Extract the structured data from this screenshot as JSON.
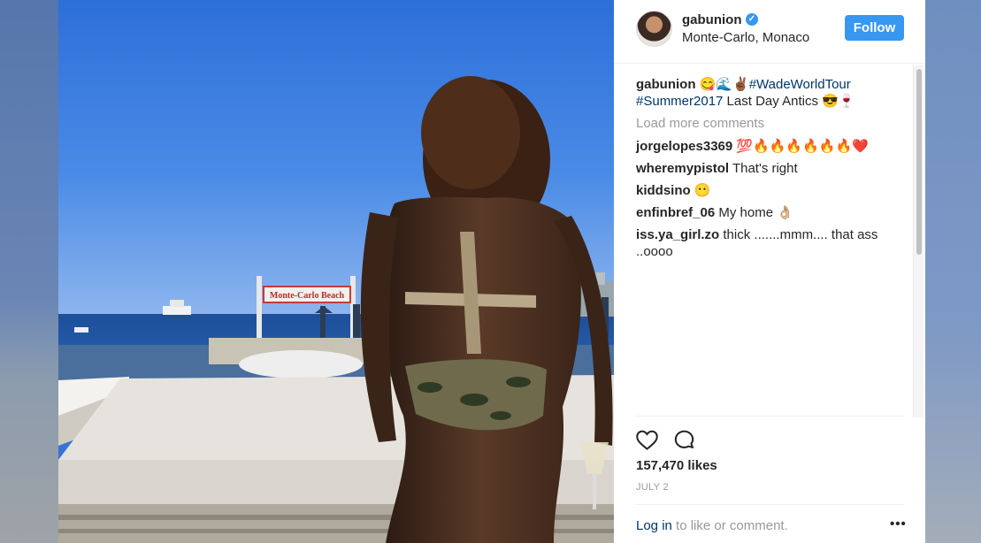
{
  "post": {
    "username": "gabunion",
    "location": "Monte-Carlo, Monaco",
    "follow_label": "Follow",
    "photo_sign_text": "Monte-Carlo Beach"
  },
  "caption": {
    "username": "gabunion",
    "emoji": "😋🌊✌🏾",
    "hashtag1": "#WadeWorldTour",
    "hashtag2": "#Summer2017",
    "text": " Last Day Antics 😎🍷"
  },
  "load_more_label": "Load more comments",
  "comments": [
    {
      "user": "jorgelopes3369",
      "text": "💯🔥🔥🔥🔥🔥🔥❤️"
    },
    {
      "user": "wheremypistol",
      "text": "That's right"
    },
    {
      "user": "kiddsino",
      "text": "😶"
    },
    {
      "user": "enfinbref_06",
      "text": "My home 👌🏼"
    },
    {
      "user": "iss.ya_girl.zo",
      "text": "thick .......mmm.... that ass ..oooo"
    }
  ],
  "likes_text": "157,470 likes",
  "date_text": "JULY 2",
  "login": {
    "link": "Log in",
    "rest": " to like or comment."
  },
  "more_label": "•••",
  "verified_glyph": "✓",
  "colors": {
    "accent": "#3897f0",
    "link": "#003569",
    "muted": "#999999",
    "text": "#262626"
  }
}
